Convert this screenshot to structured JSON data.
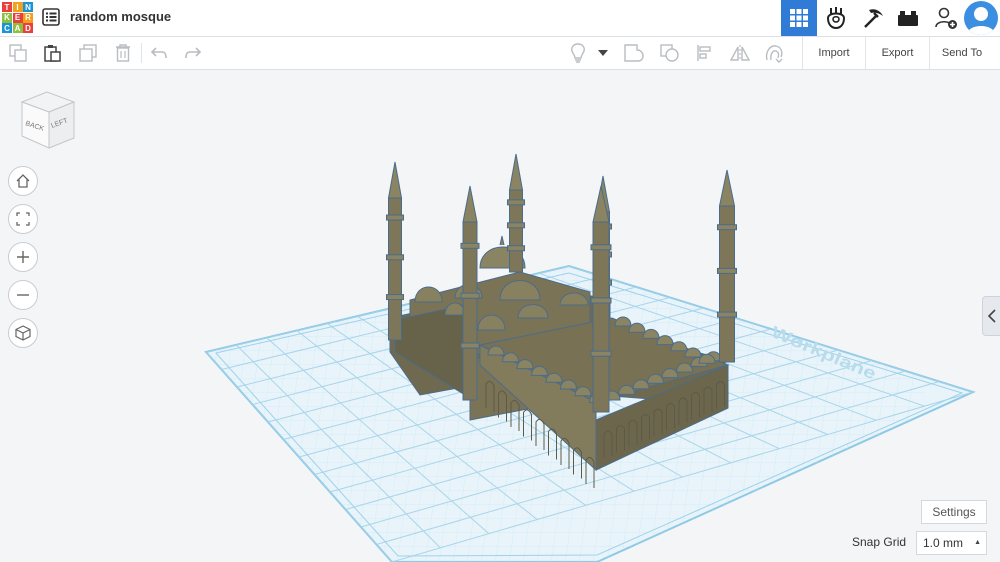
{
  "app": {
    "logo_letters": [
      "T",
      "I",
      "N",
      "K",
      "E",
      "R",
      "C",
      "A",
      "D"
    ],
    "logo_colors": [
      "#e83f3f",
      "#f5a01a",
      "#1c93d2",
      "#8fbf3f",
      "#e83f3f",
      "#f5a01a",
      "#1c93d2",
      "#8fbf3f",
      "#e83f3f"
    ],
    "design_title": "random mosque"
  },
  "topbar": {
    "icons": [
      "3d-design-icon",
      "circuits-icon",
      "codeblocks-icon",
      "bricks-icon",
      "add-user-icon",
      "user-avatar"
    ]
  },
  "toolbar": {
    "left_icons": [
      "copy-icon",
      "paste-icon",
      "duplicate-icon",
      "delete-icon",
      "undo-icon",
      "redo-icon"
    ],
    "right_icons": [
      "light-bulb-icon",
      "dropdown-arrow-icon",
      "group-icon",
      "ungroup-icon",
      "align-icon",
      "mirror-icon",
      "cruise-icon"
    ],
    "import_label": "Import",
    "export_label": "Export",
    "sendto_label": "Send To"
  },
  "viewcube": {
    "face_back": "BACK",
    "face_left": "LEFT"
  },
  "workplane": {
    "label": "Workplane"
  },
  "footer": {
    "settings_label": "Settings",
    "snap_grid_label": "Snap Grid",
    "snap_grid_value": "1.0 mm"
  },
  "colors": {
    "accent": "#2f7bd5",
    "model": "#7a7356",
    "model_edge": "#4a6c8c",
    "grid": "#8ec9e6"
  }
}
